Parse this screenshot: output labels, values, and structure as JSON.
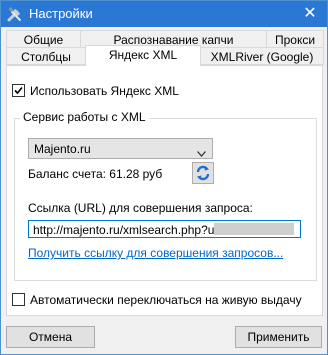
{
  "window": {
    "title": "Настройки",
    "close_glyph": "✕"
  },
  "tabs": {
    "row1": [
      "Общие",
      "Распознавание капчи",
      "Прокси"
    ],
    "row2": [
      "Столбцы",
      "Яндекс XML",
      "XMLRiver (Google)"
    ],
    "active": "Яндекс XML"
  },
  "yandex_xml": {
    "use_checkbox": {
      "label": "Использовать Яндекс XML",
      "checked": true
    },
    "group_title": "Сервис работы с XML",
    "service_select": {
      "value": "Majento.ru"
    },
    "balance_text": "Баланс счета: 61.28 руб",
    "refresh_icon": "refresh-icon",
    "url_label": "Ссылка (URL) для совершения запроса:",
    "url_value": "http://majento.ru/xmlsearch.php?user=",
    "get_link": "Получить ссылку для совершения запросов...",
    "auto_switch_checkbox": {
      "label": "Автоматически переключаться на живую выдачу",
      "checked": false
    }
  },
  "footer": {
    "cancel_label": "Отмена",
    "apply_label": "Применить"
  },
  "colors": {
    "titlebar": "#2b78d4",
    "link": "#0066cc",
    "focus_border": "#0078d7"
  }
}
